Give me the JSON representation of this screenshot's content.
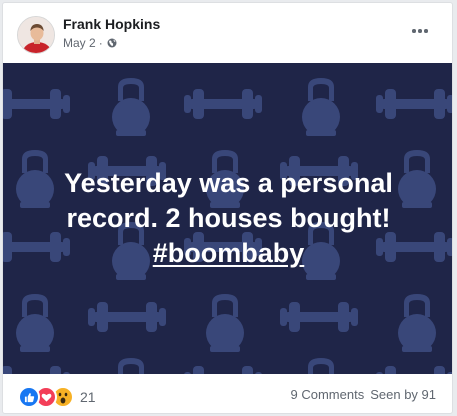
{
  "post": {
    "author": "Frank Hopkins",
    "date": "May 2",
    "separator": "·",
    "privacy_icon": "globe-icon",
    "more_icon": "more-options-icon",
    "banner": {
      "line1": "Yesterday was a personal",
      "line2": "record. 2 houses bought!",
      "hashtag": "#boombaby",
      "background_color": "#1f2548",
      "pattern_color": "#3c4a7e",
      "pattern_icons": [
        "dumbbell-icon",
        "kettlebell-icon"
      ]
    },
    "reactions": {
      "icons": [
        "like-icon",
        "love-icon",
        "wow-icon"
      ],
      "count": "21"
    },
    "stats": {
      "comments": "9 Comments",
      "seen": "Seen by 91"
    }
  },
  "colors": {
    "like": "#1877f2",
    "love": "#f33e58",
    "wow": "#f7b125",
    "text_secondary": "#606770"
  }
}
